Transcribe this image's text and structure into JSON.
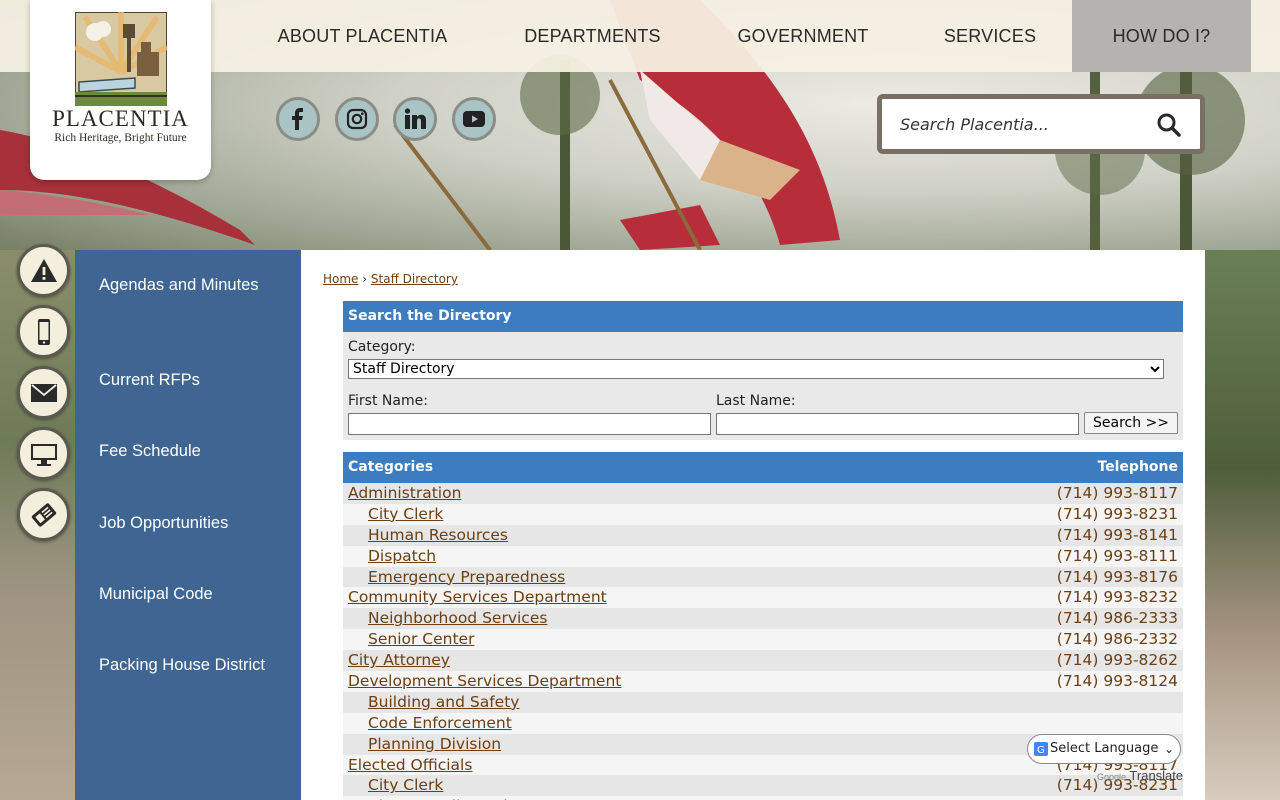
{
  "nav": {
    "items": [
      {
        "label": "ABOUT PLACENTIA"
      },
      {
        "label": "DEPARTMENTS"
      },
      {
        "label": "GOVERNMENT"
      },
      {
        "label": "SERVICES"
      },
      {
        "label": "HOW DO I?"
      }
    ]
  },
  "logo": {
    "name": "PLACENTIA",
    "tagline": "Rich Heritage, Bright Future"
  },
  "social": [
    "facebook-icon",
    "instagram-icon",
    "linkedin-icon",
    "youtube-icon"
  ],
  "search": {
    "placeholder": "Search Placentia..."
  },
  "side_icons": [
    "alert-icon",
    "mobile-phone-icon",
    "email-icon",
    "monitor-icon",
    "news-icon"
  ],
  "sidebar": {
    "links": [
      {
        "label": "Agendas and Minutes"
      },
      {
        "label": "Current RFPs"
      },
      {
        "label": "Fee Schedule"
      },
      {
        "label": "Job Opportunities"
      },
      {
        "label": "Municipal Code"
      },
      {
        "label": "Packing House District"
      }
    ]
  },
  "breadcrumb": {
    "home": "Home",
    "separator": "›",
    "current": "Staff Directory"
  },
  "directory_search": {
    "title": "Search the Directory",
    "category_label": "Category:",
    "category_value": "Staff Directory",
    "first_name_label": "First Name:",
    "last_name_label": "Last Name:",
    "button": "Search >>"
  },
  "categories": {
    "header_left": "Categories",
    "header_right": "Telephone",
    "rows": [
      {
        "name": "Administration",
        "phone": "(714) 993-8117",
        "indent": false
      },
      {
        "name": "City Clerk",
        "phone": "(714) 993-8231",
        "indent": true
      },
      {
        "name": "Human Resources",
        "phone": "(714) 993-8141",
        "indent": true
      },
      {
        "name": "Dispatch",
        "phone": "(714) 993-8111",
        "indent": true
      },
      {
        "name": "Emergency Preparedness",
        "phone": "(714) 993-8176",
        "indent": true
      },
      {
        "name": "Community Services Department",
        "phone": "(714) 993-8232",
        "indent": false
      },
      {
        "name": "Neighborhood Services",
        "phone": "(714) 986-2333",
        "indent": true
      },
      {
        "name": "Senior Center",
        "phone": "(714) 986-2332",
        "indent": true
      },
      {
        "name": "City Attorney",
        "phone": "(714) 993-8262",
        "indent": false
      },
      {
        "name": "Development Services Department",
        "phone": "(714) 993-8124",
        "indent": false
      },
      {
        "name": "Building and Safety",
        "phone": "",
        "indent": true
      },
      {
        "name": "Code Enforcement",
        "phone": "",
        "indent": true
      },
      {
        "name": "Planning Division",
        "phone": "",
        "indent": true
      },
      {
        "name": "Elected Officials",
        "phone": "(714) 993-8117",
        "indent": false
      },
      {
        "name": "City Clerk",
        "phone": "(714) 993-8231",
        "indent": true
      },
      {
        "name": "City Council Members",
        "phone": "",
        "indent": true
      }
    ]
  },
  "translate": {
    "label": "Select Language",
    "powered_by": "Google",
    "brand": "Translate"
  },
  "colors": {
    "nav_bg": "#f6f0e2",
    "sidebar": "#3f6592",
    "header_blue": "#3c7cc0",
    "link_brown": "#6b3f12"
  }
}
